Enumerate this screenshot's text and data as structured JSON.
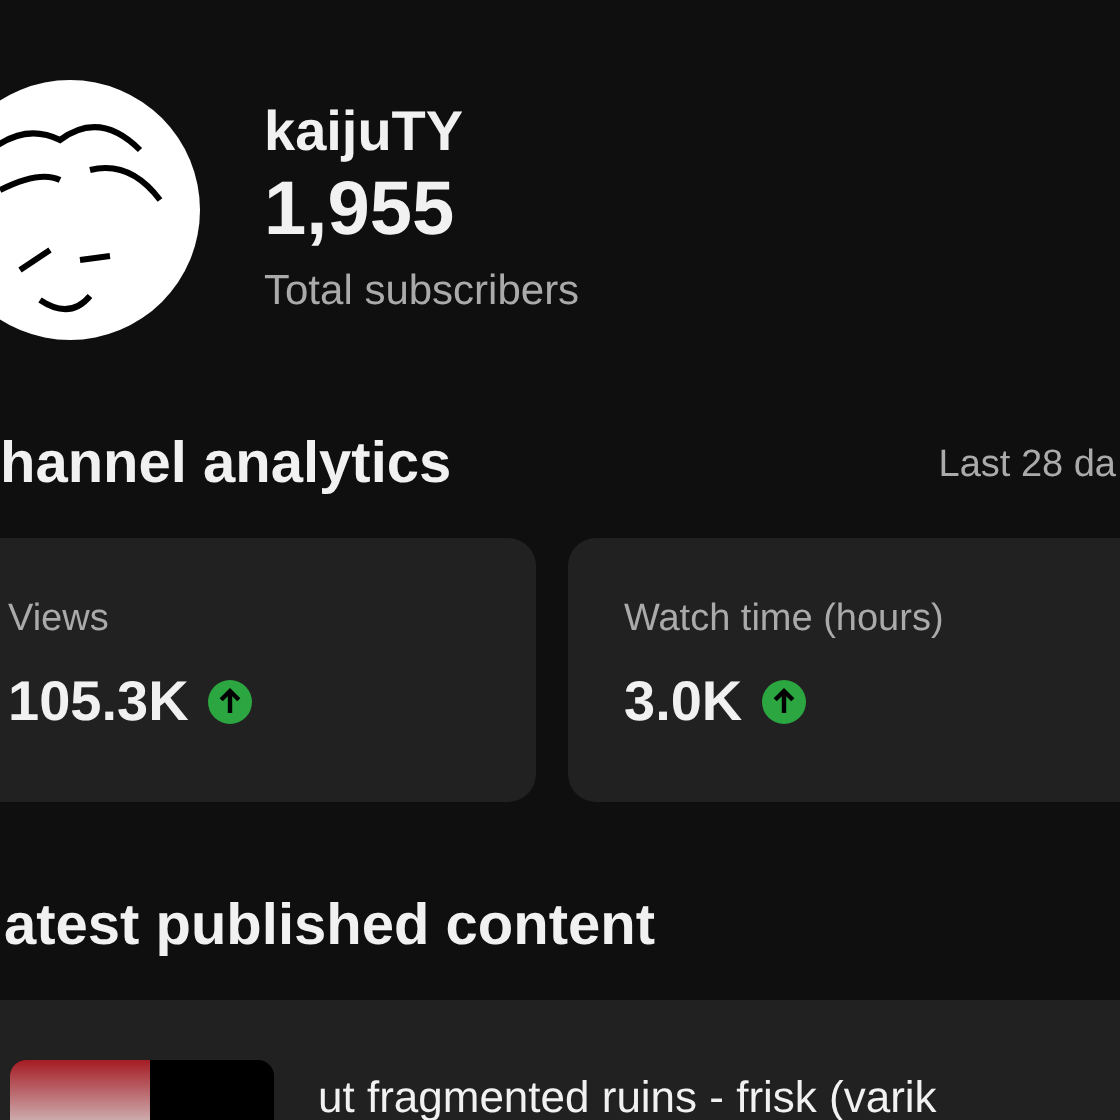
{
  "channel": {
    "name": "kaijuTY",
    "subscribers": "1,955",
    "subscribers_label": "Total subscribers"
  },
  "analytics": {
    "title": "hannel analytics",
    "period": "Last 28 da",
    "cards": [
      {
        "label": "Views",
        "value": "105.3K",
        "rising": true
      },
      {
        "label": "Watch time (hours)",
        "value": "3.0K",
        "rising": true
      }
    ]
  },
  "latest": {
    "title": "atest published content",
    "video": {
      "title": "ut fragmented ruins - frisk (varik"
    }
  }
}
